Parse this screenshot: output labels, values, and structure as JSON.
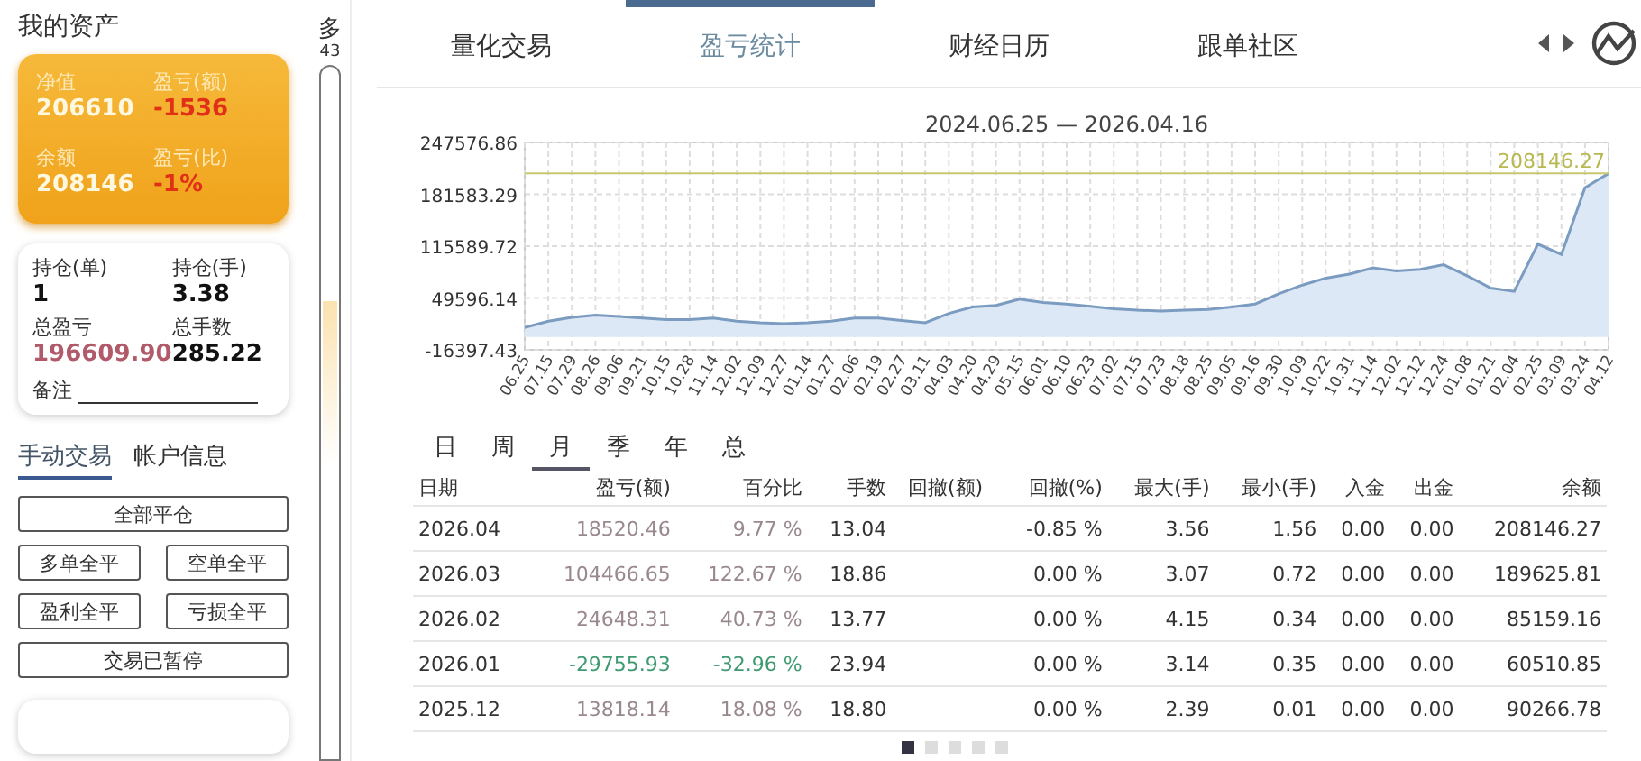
{
  "assets": {
    "title": "我的资产",
    "summary": [
      {
        "label": "净值",
        "value": "206610",
        "kind": "plain"
      },
      {
        "label": "盈亏(额)",
        "value": "-1536",
        "kind": "loss"
      },
      {
        "label": "余额",
        "value": "208146",
        "kind": "plain"
      },
      {
        "label": "盈亏(比)",
        "value": "-1%",
        "kind": "loss"
      }
    ],
    "positions": [
      {
        "label": "持仓(单)",
        "value": "1",
        "kind": "plain"
      },
      {
        "label": "持仓(手)",
        "value": "3.38",
        "kind": "plain"
      },
      {
        "label": "总盈亏",
        "value": "196609.90",
        "kind": "profit"
      },
      {
        "label": "总手数",
        "value": "285.22",
        "kind": "plain"
      }
    ],
    "note_label": "备注"
  },
  "side_tabs": [
    {
      "label": "手动交易",
      "selected": true
    },
    {
      "label": "帐户信息",
      "selected": false
    }
  ],
  "trade_buttons": [
    {
      "label": "全部平仓",
      "kind": "wide"
    },
    {
      "label": "多单全平",
      "kind": "half"
    },
    {
      "label": "空单全平",
      "kind": "half"
    },
    {
      "label": "盈利全平",
      "kind": "half"
    },
    {
      "label": "亏损全平",
      "kind": "half"
    },
    {
      "label": "交易已暂停",
      "kind": "wide"
    }
  ],
  "scroll_label": "多",
  "scroll_count": "43",
  "tabs": [
    {
      "label": "量化交易",
      "selected": false
    },
    {
      "label": "盈亏统计",
      "selected": true
    },
    {
      "label": "财经日历",
      "selected": false
    },
    {
      "label": "跟单社区",
      "selected": false
    }
  ],
  "chart": {
    "chart_data": {
      "type": "area",
      "title": "2024.06.25 — 2026.04.16",
      "categories": [
        "06.25",
        "07.15",
        "07.29",
        "08.26",
        "09.06",
        "09.21",
        "10.15",
        "10.28",
        "11.14",
        "12.02",
        "12.09",
        "12.27",
        "01.14",
        "01.27",
        "02.06",
        "02.19",
        "02.27",
        "03.11",
        "04.03",
        "04.20",
        "04.29",
        "05.15",
        "06.01",
        "06.10",
        "06.23",
        "07.02",
        "07.15",
        "07.23",
        "08.18",
        "08.25",
        "09.05",
        "09.16",
        "09.30",
        "10.09",
        "10.22",
        "10.31",
        "11.14",
        "12.02",
        "12.12",
        "12.24",
        "01.08",
        "01.21",
        "02.04",
        "02.25",
        "03.09",
        "03.24",
        "04.12"
      ],
      "grid": true,
      "series": [
        {
          "color": "#7b9cc0",
          "values": [
            12000,
            20000,
            25000,
            28000,
            26000,
            24000,
            22000,
            22000,
            24000,
            20000,
            18000,
            17000,
            18000,
            20000,
            24000,
            24000,
            21000,
            18000,
            30000,
            38000,
            40000,
            48000,
            44000,
            42000,
            39000,
            36000,
            34000,
            33000,
            34000,
            35000,
            38000,
            42000,
            55000,
            66000,
            75000,
            80000,
            88000,
            84000,
            86000,
            92000,
            78000,
            62000,
            58000,
            118000,
            105000,
            190000,
            208000
          ]
        }
      ],
      "ylim": [
        -16397.43,
        247576.86
      ],
      "yticks": [
        -16397.43,
        49596.14,
        115589.72,
        181583.29,
        247576.86
      ],
      "ref_lines": [
        {
          "axis": "y",
          "value": 208146.27,
          "label": "208146.27"
        }
      ]
    }
  },
  "periods": [
    {
      "label": "日",
      "selected": false
    },
    {
      "label": "周",
      "selected": false
    },
    {
      "label": "月",
      "selected": true
    },
    {
      "label": "季",
      "selected": false
    },
    {
      "label": "年",
      "selected": false
    },
    {
      "label": "总",
      "selected": false
    }
  ],
  "table": {
    "columns": [
      "日期",
      "盈亏(额)",
      "百分比",
      "手数",
      "回撤(额)",
      "回撤(%)",
      "最大(手)",
      "最小(手)",
      "入金",
      "出金",
      "余额"
    ],
    "rows": [
      {
        "color": "#9a8890",
        "cells": [
          "2026.04",
          "18520.46",
          "9.77 %",
          "13.04",
          "",
          "-0.85 %",
          "3.56",
          "1.56",
          "0.00",
          "0.00",
          "208146.27"
        ]
      },
      {
        "color": "#9a8890",
        "cells": [
          "2026.03",
          "104466.65",
          "122.67 %",
          "18.86",
          "",
          "0.00 %",
          "3.07",
          "0.72",
          "0.00",
          "0.00",
          "189625.81"
        ]
      },
      {
        "color": "#9a8890",
        "cells": [
          "2026.02",
          "24648.31",
          "40.73 %",
          "13.77",
          "",
          "0.00 %",
          "4.15",
          "0.34",
          "0.00",
          "0.00",
          "85159.16"
        ]
      },
      {
        "color": "#3f9a72",
        "cells": [
          "2026.01",
          "-29755.93",
          "-32.96 %",
          "23.94",
          "",
          "0.00 %",
          "3.14",
          "0.35",
          "0.00",
          "0.00",
          "60510.85"
        ]
      },
      {
        "color": "#9a8890",
        "cells": [
          "2025.12",
          "13818.14",
          "18.08 %",
          "18.80",
          "",
          "0.00 %",
          "2.39",
          "0.01",
          "0.00",
          "0.00",
          "90266.78"
        ]
      }
    ]
  },
  "pages": [
    {
      "selected": true
    },
    {
      "selected": false
    },
    {
      "selected": false
    },
    {
      "selected": false
    },
    {
      "selected": false
    }
  ]
}
